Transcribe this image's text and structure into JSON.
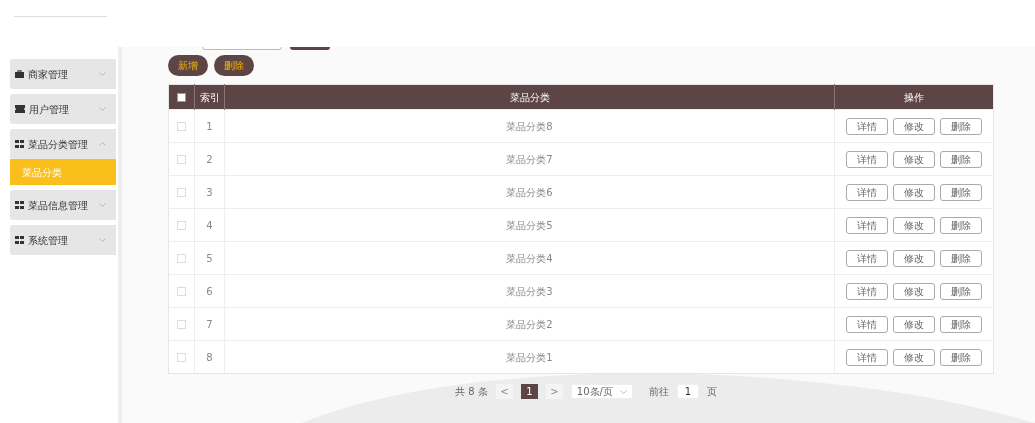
{
  "sidebar": {
    "items": [
      {
        "label": "商家管理",
        "expanded": false
      },
      {
        "label": "用户管理",
        "expanded": false
      },
      {
        "label": "菜品分类管理",
        "expanded": true,
        "children": [
          {
            "label": "菜品分类",
            "selected": true
          }
        ]
      },
      {
        "label": "菜品信息管理",
        "expanded": false
      },
      {
        "label": "系统管理",
        "expanded": false
      }
    ]
  },
  "toolbar": {
    "buttons": [
      "新增",
      "删除"
    ]
  },
  "table": {
    "columns": [
      "索引",
      "菜品分类",
      "操作"
    ],
    "all_checked": false,
    "rows": [
      {
        "index": "1",
        "name": "菜品分类8",
        "checked": false,
        "actions": [
          "详情",
          "修改",
          "删除"
        ]
      },
      {
        "index": "2",
        "name": "菜品分类7",
        "checked": false,
        "actions": [
          "详情",
          "修改",
          "删除"
        ]
      },
      {
        "index": "3",
        "name": "菜品分类6",
        "checked": false,
        "actions": [
          "详情",
          "修改",
          "删除"
        ]
      },
      {
        "index": "4",
        "name": "菜品分类5",
        "checked": false,
        "actions": [
          "详情",
          "修改",
          "删除"
        ]
      },
      {
        "index": "5",
        "name": "菜品分类4",
        "checked": false,
        "actions": [
          "详情",
          "修改",
          "删除"
        ]
      },
      {
        "index": "6",
        "name": "菜品分类3",
        "checked": false,
        "actions": [
          "详情",
          "修改",
          "删除"
        ]
      },
      {
        "index": "7",
        "name": "菜品分类2",
        "checked": false,
        "actions": [
          "详情",
          "修改",
          "删除"
        ]
      },
      {
        "index": "8",
        "name": "菜品分类1",
        "checked": false,
        "actions": [
          "详情",
          "修改",
          "删除"
        ]
      }
    ]
  },
  "pagination": {
    "total": "共 8 条",
    "prev": "<",
    "pages": [
      {
        "label": "1",
        "selected": true
      }
    ],
    "next": ">",
    "page_size": "10条/页",
    "goto_label": "前往",
    "goto_value": "1",
    "goto_suffix": "页"
  }
}
